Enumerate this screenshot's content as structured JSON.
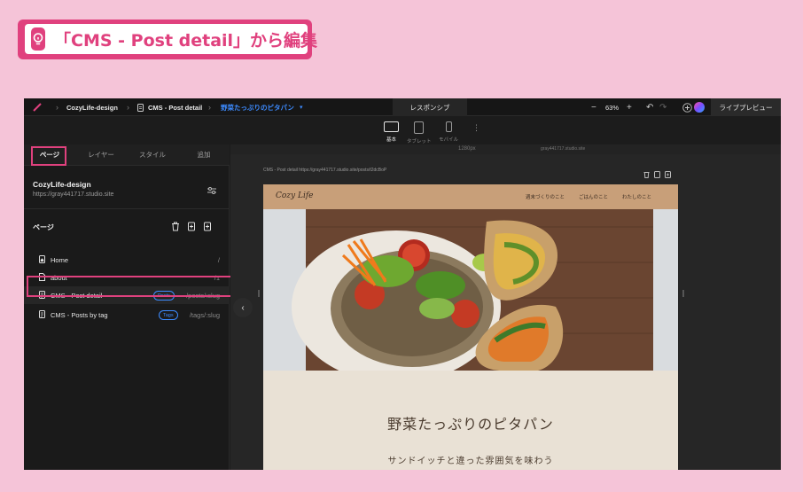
{
  "heading": {
    "text": "「CMS - Post detail」から編集"
  },
  "topbar": {
    "project": "CozyLife-design",
    "template": "CMS - Post detail",
    "page": "野菜たっぷりのピタパン",
    "mode_tab": "レスポンシブ",
    "zoom": "63%",
    "live_preview": "ライブプレビュー"
  },
  "devices": [
    {
      "label": "基本"
    },
    {
      "label": "タブレット"
    },
    {
      "label": "モバイル"
    }
  ],
  "ruler": {
    "width_label": "1280px",
    "domain_label": "gray441717.studio.site"
  },
  "panel": {
    "tabs": [
      "ページ",
      "レイヤー",
      "スタイル",
      "追加"
    ],
    "site_name": "CozyLife-design",
    "site_url": "https://gray441717.studio.site",
    "pages_title": "ページ",
    "pages": [
      {
        "label": "Home",
        "path": "/",
        "tag": ""
      },
      {
        "label": "about",
        "path": "/1",
        "tag": ""
      },
      {
        "label": "CMS - Post detail",
        "path": "/posts/:slug",
        "tag": "Posts"
      },
      {
        "label": "CMS - Posts by tag",
        "path": "/tags/:slug",
        "tag": "Tags"
      }
    ]
  },
  "frame": {
    "url_text": "CMS - Post detail  https://gray441717.studio.site/posts/t2dcBoP"
  },
  "site": {
    "logo": "Cozy Life",
    "nav": [
      "週末づくりのこと",
      "ごはんのこと",
      "わたしのこと"
    ],
    "title": "野菜たっぷりのピタパン",
    "subtitle": "サンドイッチと違った雰囲気を味わう"
  },
  "colors": {
    "background": "#f5c4d8",
    "accent": "#e0417e",
    "link_blue": "#3d8bff",
    "site_header": "#c89f79",
    "site_body": "#e9e1d5"
  }
}
